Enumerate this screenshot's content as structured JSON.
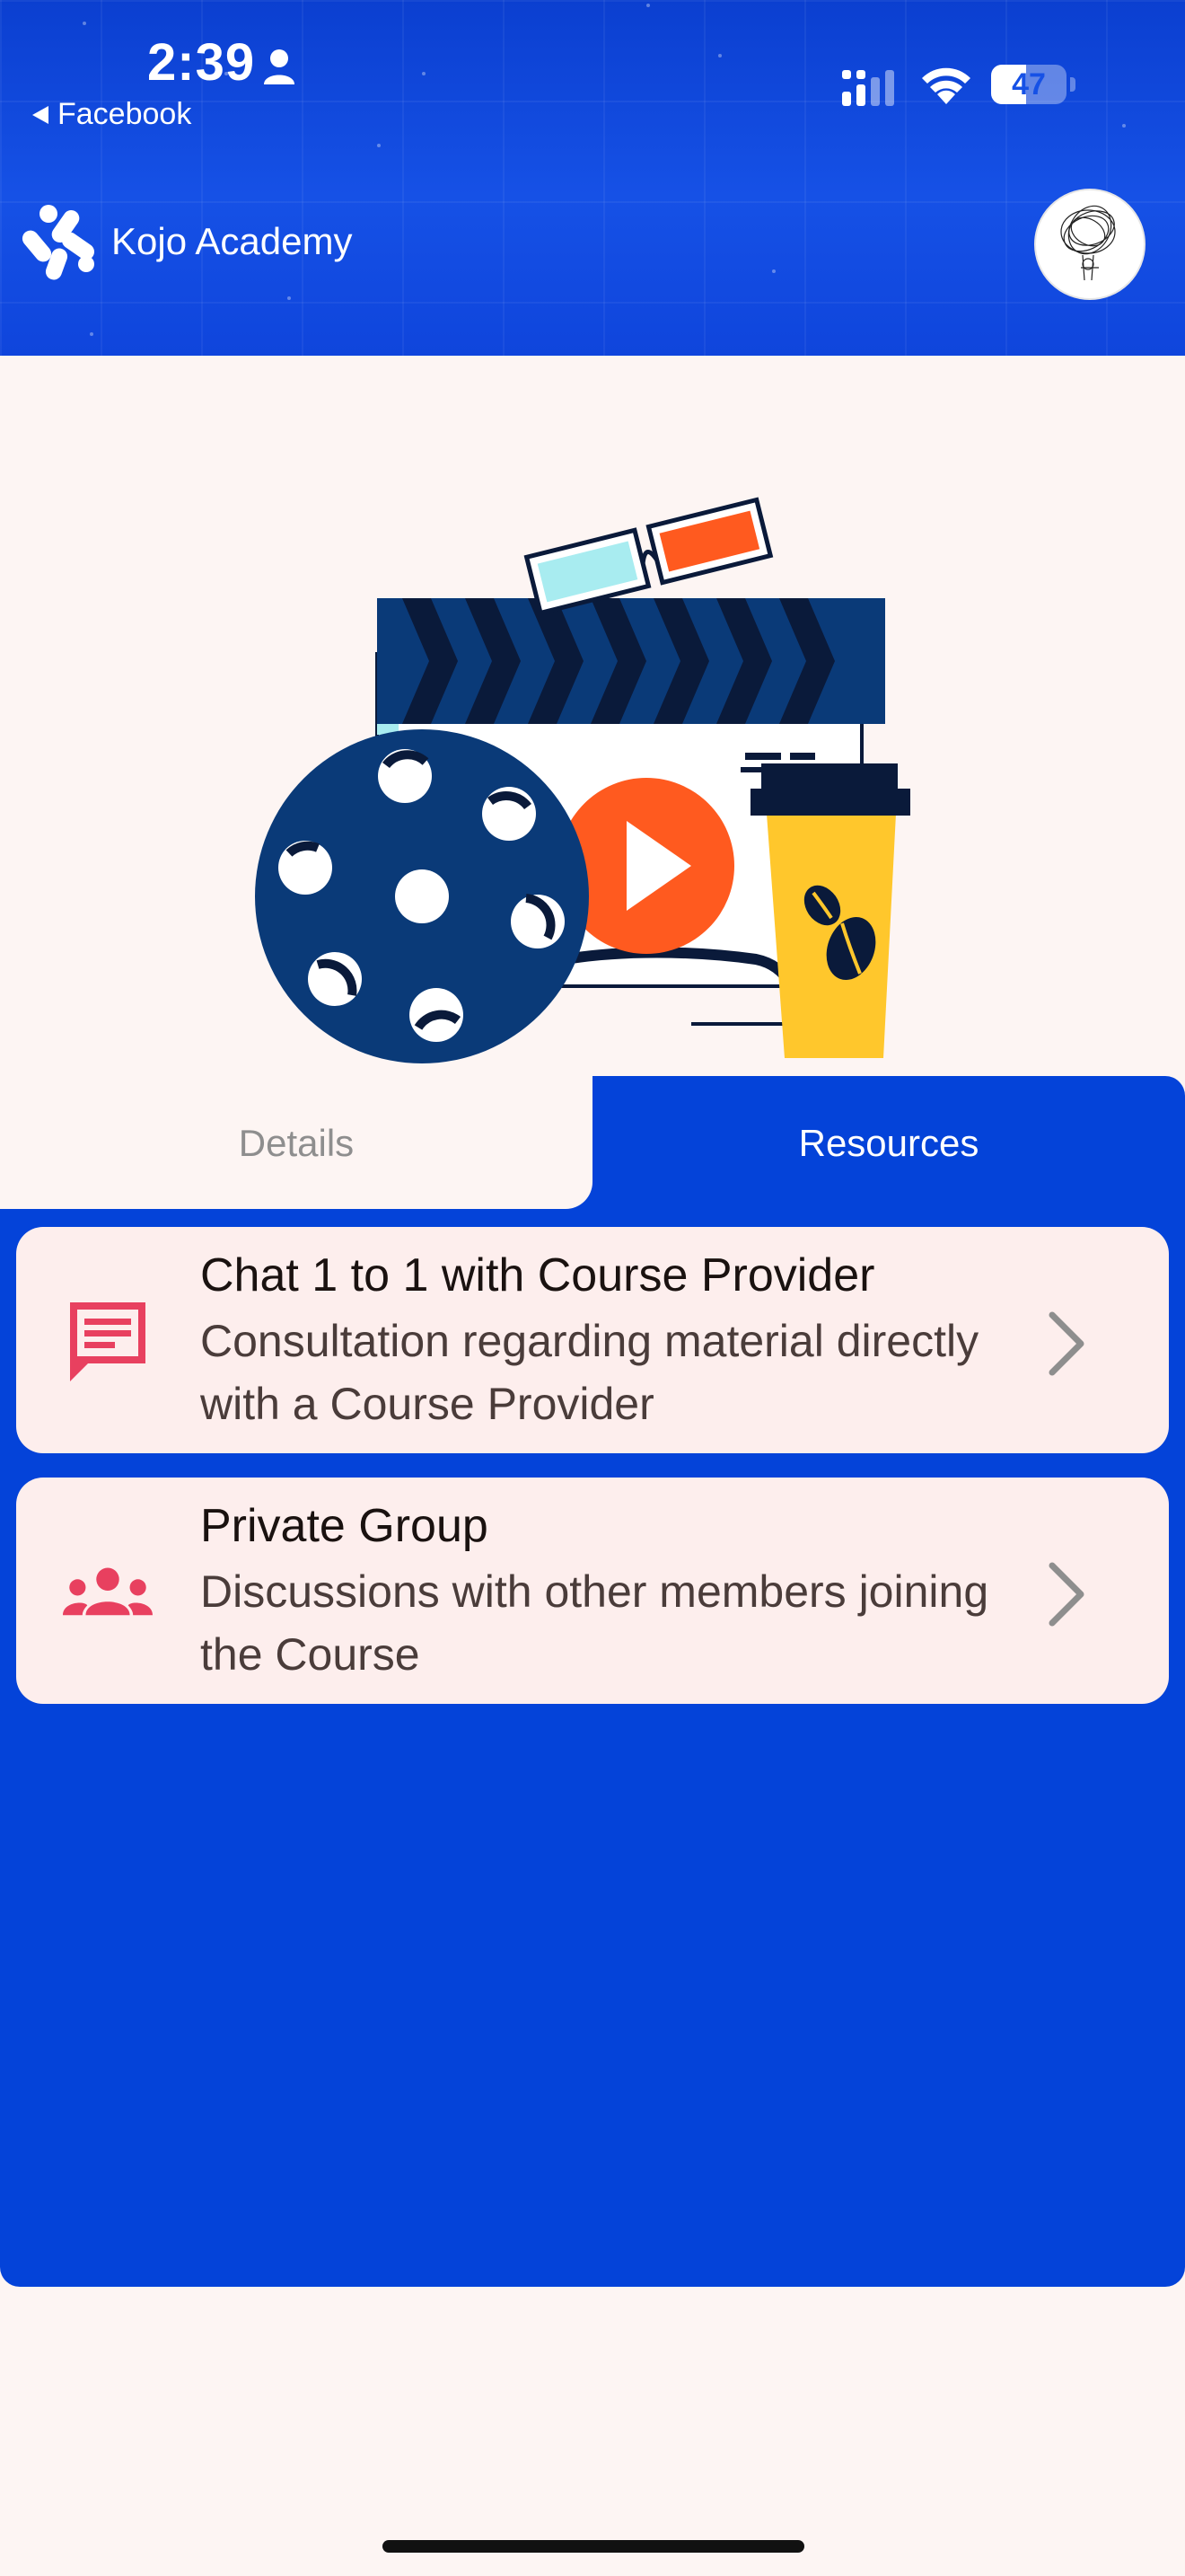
{
  "status_bar": {
    "time": "2:39",
    "back_app": "Facebook",
    "battery": "47",
    "battery_level": 0.47
  },
  "header": {
    "brand_name": "Kojo Academy"
  },
  "tabs": [
    {
      "label": "Details",
      "active": false
    },
    {
      "label": "Resources",
      "active": true
    }
  ],
  "resources": [
    {
      "icon": "chat-bubble-icon",
      "title": "Chat 1 to 1 with Course Provider",
      "description": "Consultation regarding material directly with a Course Provider"
    },
    {
      "icon": "group-icon",
      "title": "Private Group",
      "description": "Discussions with other members joining the Course"
    }
  ],
  "colors": {
    "primary": "#0443d9",
    "accent_icon": "#e8405f",
    "background": "#fdf5f3",
    "card": "#fdeeed"
  }
}
